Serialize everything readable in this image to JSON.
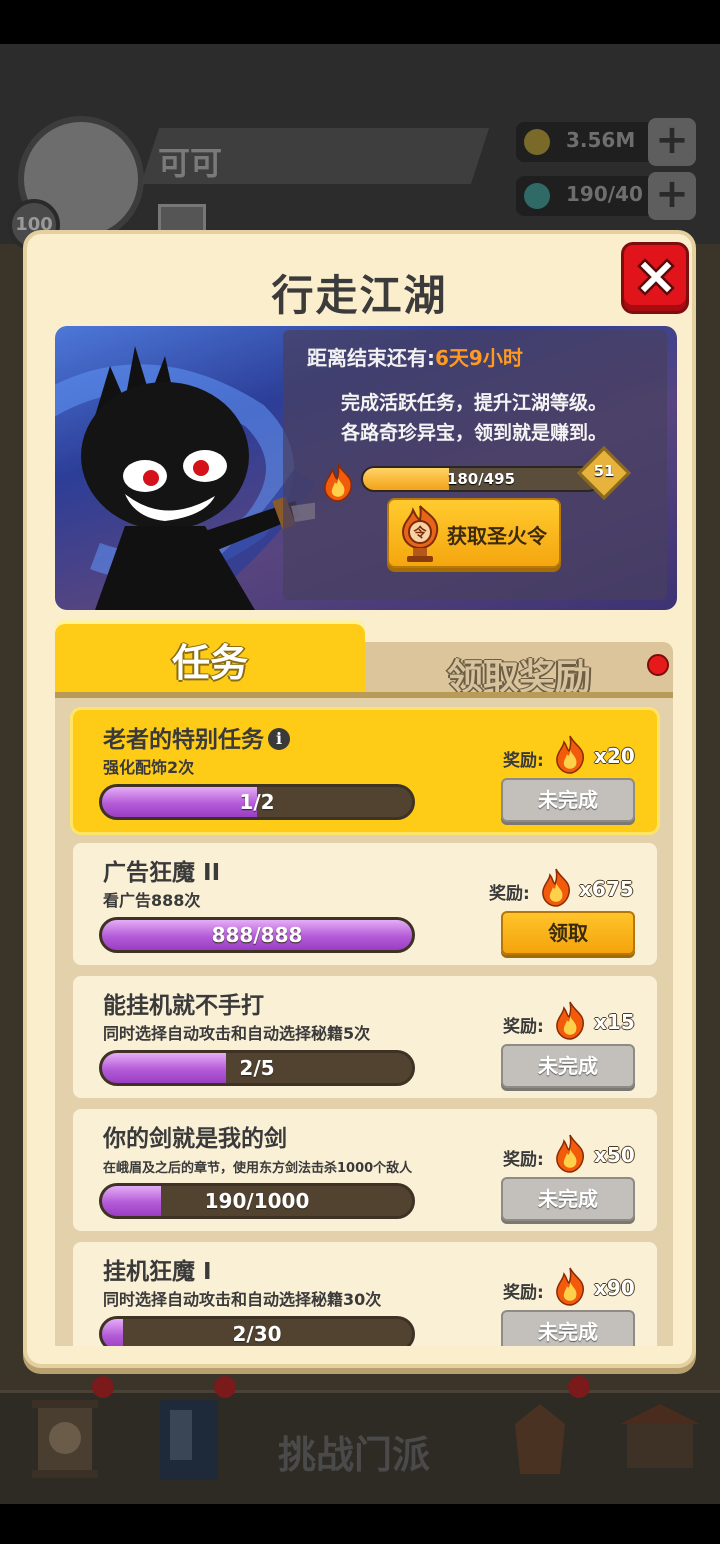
{
  "background": {
    "player_name": "可可",
    "player_level": "100",
    "gold": "3.56M",
    "energy": "190/40",
    "bottom_center_label": "挑战门派"
  },
  "modal": {
    "title": "行走江湖",
    "banner": {
      "end_prefix": "距离结束还有:",
      "end_value": "6天9小时",
      "desc_line1": "完成活跃任务，提升江湖等级。",
      "desc_line2": "各路奇珍异宝，领到就是赚到。",
      "progress_text": "180/495",
      "progress_value": 180,
      "progress_max": 495,
      "level": "51",
      "get_button_label": "获取圣火令"
    },
    "tabs": {
      "tasks_label": "任务",
      "rewards_label": "领取奖励"
    },
    "reward_prefix": "奖励:",
    "tasks": [
      {
        "title": "老者的特别任务",
        "desc": "强化配饰2次",
        "progress_text": "1/2",
        "current": 1,
        "total": 2,
        "reward": "x20",
        "button": "未完成"
      },
      {
        "title": "广告狂魔 II",
        "desc": "看广告888次",
        "progress_text": "888/888",
        "current": 888,
        "total": 888,
        "reward": "x675",
        "button": "领取"
      },
      {
        "title": "能挂机就不手打",
        "desc": "同时选择自动攻击和自动选择秘籍5次",
        "progress_text": "2/5",
        "current": 2,
        "total": 5,
        "reward": "x15",
        "button": "未完成"
      },
      {
        "title": "你的剑就是我的剑",
        "desc": "在峨眉及之后的章节，使用东方剑法击杀1000个敌人",
        "progress_text": "190/1000",
        "current": 190,
        "total": 1000,
        "reward": "x50",
        "button": "未完成"
      },
      {
        "title": "挂机狂魔 I",
        "desc": "同时选择自动攻击和自动选择秘籍30次",
        "progress_text": "2/30",
        "current": 2,
        "total": 30,
        "reward": "x90",
        "button": "未完成"
      }
    ]
  },
  "icons": {
    "close": "close-x-icon",
    "fire": "flame-icon",
    "token": "fire-token-icon",
    "info": "info-icon"
  },
  "colors": {
    "modal_bg": "#fbeecd",
    "accent_yellow": "#fecc16",
    "progress_purple": "#b45bd8",
    "close_red": "#e0141a",
    "time_orange": "#ff9a1e"
  }
}
